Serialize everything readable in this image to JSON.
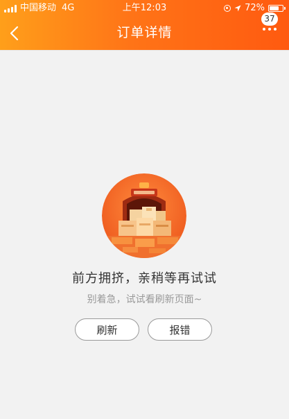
{
  "status_bar": {
    "carrier": "中国移动",
    "network": "4G",
    "time": "上午12:03",
    "battery_percent": "72%",
    "battery_level": 0.72
  },
  "nav": {
    "title": "订单详情",
    "message_count": "37",
    "back_icon": "chevron-left-icon",
    "more_icon": "more-dots-icon"
  },
  "error": {
    "illustration": "crowded-warehouse-illustration",
    "message": "前方拥挤，亲稍等再试试",
    "hint": "别着急，试试看刷新页面~",
    "refresh_label": "刷新",
    "report_label": "报错"
  },
  "colors": {
    "header_start": "#ff9f1a",
    "header_end": "#ff5a10",
    "illustration_bg": "#f26a28",
    "background": "#f2f2f2"
  }
}
